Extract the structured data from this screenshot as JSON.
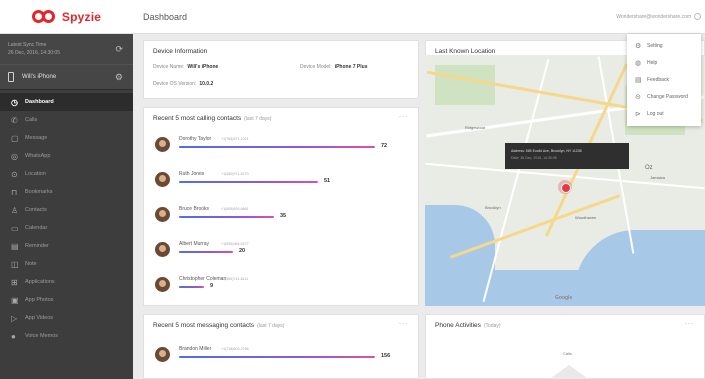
{
  "brand": {
    "name": "Spyzie"
  },
  "sidebar": {
    "sync_line1": "Latest Sync Time",
    "sync_line2": "26 Dec, 2016, 14:30:05",
    "device_name": "Will's iPhone",
    "items": [
      {
        "label": "Dashboard",
        "icon": "clock-icon",
        "glyph": "◷",
        "active": true
      },
      {
        "label": "Calls",
        "icon": "phone-icon",
        "glyph": "✆"
      },
      {
        "label": "Message",
        "icon": "message-icon",
        "glyph": "▢"
      },
      {
        "label": "WhatsApp",
        "icon": "whatsapp-icon",
        "glyph": "◎"
      },
      {
        "label": "Location",
        "icon": "location-icon",
        "glyph": "⊙"
      },
      {
        "label": "Bookmarks",
        "icon": "bookmark-icon",
        "glyph": "⊓"
      },
      {
        "label": "Contacts",
        "icon": "contacts-icon",
        "glyph": "♙"
      },
      {
        "label": "Calendar",
        "icon": "calendar-icon",
        "glyph": "▭"
      },
      {
        "label": "Reminder",
        "icon": "reminder-icon",
        "glyph": "▤"
      },
      {
        "label": "Note",
        "icon": "note-icon",
        "glyph": "◫"
      },
      {
        "label": "Applications",
        "icon": "apps-icon",
        "glyph": "⊞"
      },
      {
        "label": "App Photos",
        "icon": "photos-icon",
        "glyph": "▣"
      },
      {
        "label": "App Videos",
        "icon": "videos-icon",
        "glyph": "▷"
      },
      {
        "label": "Voice Memos",
        "icon": "mic-icon",
        "glyph": "●"
      }
    ]
  },
  "header": {
    "title": "Dashboard",
    "user": "Wondershare@wondershare.com"
  },
  "device_info": {
    "title": "Device Information",
    "name_label": "Device Name:",
    "name_value": "Will's iPhone",
    "model_label": "Device Model:",
    "model_value": "iPhone 7 Plus",
    "os_label": "Device OS Version:",
    "os_value": "10.0.2"
  },
  "calling": {
    "title": "Recent 5 most calling contacts",
    "sub": "(last 7 days)",
    "max": 72,
    "contacts": [
      {
        "name": "Dorothy Taylor",
        "phone": "+1(765)971-1021",
        "count": 72
      },
      {
        "name": "Ruth Jones",
        "phone": "+1(480)971-5170",
        "count": 51
      },
      {
        "name": "Bruce Brooks",
        "phone": "+1(505)693-6661",
        "count": 35
      },
      {
        "name": "Albert Murray",
        "phone": "+1(555)964-0177",
        "count": 20
      },
      {
        "name": "Christopher Coleman",
        "phone": "+1(585)741-6111",
        "count": 9
      }
    ]
  },
  "messaging": {
    "title": "Recent 5 most messaging contacts",
    "sub": "(last 7 days)",
    "max": 156,
    "contacts": [
      {
        "name": "Brandon Miller",
        "phone": "+1(718)603-2796",
        "count": 156
      }
    ]
  },
  "location": {
    "title": "Last Known Location",
    "address": "Address: 565 Euclid Ave, Brooklyn, NY 11208",
    "time": "Date: 26 Dec, 2016, 14:30:05",
    "map_labels": [
      "Ridgewood",
      "Queens",
      "Brooklyn",
      "Jamaica",
      "Woodhaven",
      "Oz"
    ],
    "attribution": "Google"
  },
  "activities": {
    "title": "Phone Activities",
    "sub": "(Today)",
    "calls_label": "Calls"
  },
  "dropdown": {
    "items": [
      {
        "label": "Setting",
        "icon": "gear-icon",
        "glyph": "⚙"
      },
      {
        "label": "Help",
        "icon": "help-icon",
        "glyph": "◍"
      },
      {
        "label": "Feedback",
        "icon": "feedback-icon",
        "glyph": "▤"
      },
      {
        "label": "Change Password",
        "icon": "lock-icon",
        "glyph": "⊝"
      },
      {
        "label": "Log out",
        "icon": "logout-icon",
        "glyph": "⊳"
      }
    ]
  },
  "card_menu": "···"
}
